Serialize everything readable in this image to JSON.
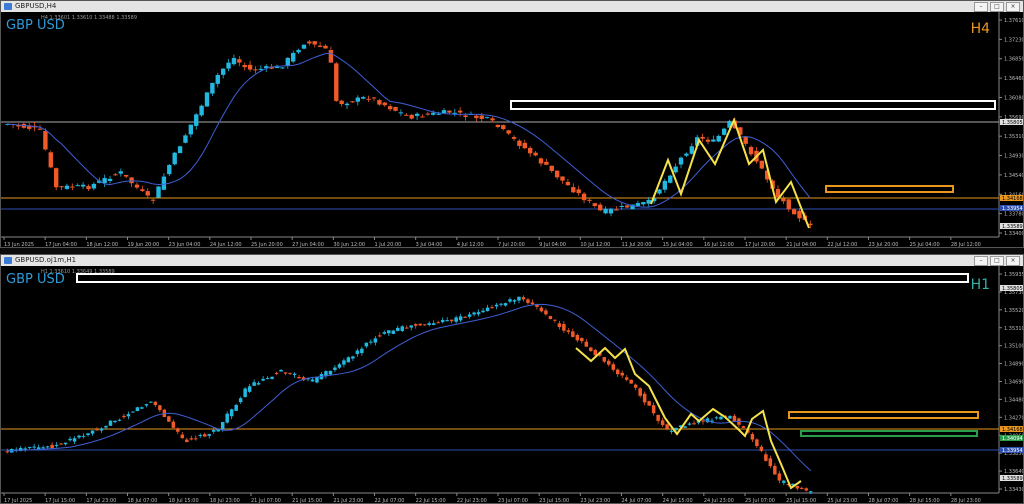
{
  "windows": [
    {
      "title": "GBPUSD,H4",
      "ohlc": "H4 1.33601 1.33610 1.33488 1.33589",
      "symbol": "GBP USD",
      "timeframe": "H4",
      "timeframe_color": "#e8961e",
      "price_labels": [
        "1.37610",
        "1.37230",
        "1.36850",
        "1.36460",
        "1.36080",
        "1.35690",
        "1.35310",
        "1.34930",
        "1.34540",
        "1.34160",
        "1.33780",
        "1.33400"
      ],
      "markers": [
        {
          "text": "1.35805",
          "price": 1.35805,
          "bg": "#e0e0e0",
          "fg": "#000000"
        },
        {
          "text": "1.34168",
          "price": 1.34168,
          "bg": "#e8961e",
          "fg": "#000000"
        },
        {
          "text": "1.33954",
          "price": 1.33954,
          "bg": "#2f4fb0",
          "fg": "#ffffff"
        },
        {
          "text": "1.33589",
          "price": 1.33589,
          "bg": "#e0e0e0",
          "fg": "#000000"
        }
      ],
      "time_labels": [
        "13 Jun 2025",
        "17 Jun 04:00",
        "18 Jun 12:00",
        "19 Jun 20:00",
        "23 Jun 04:00",
        "24 Jun 12:00",
        "25 Jun 20:00",
        "27 Jun 04:00",
        "30 Jun 12:00",
        "1 Jul 20:00",
        "3 Jul 04:00",
        "4 Jul 12:00",
        "7 Jul 20:00",
        "9 Jul 04:00",
        "10 Jul 12:00",
        "11 Jul 20:00",
        "15 Jul 04:00",
        "16 Jul 12:00",
        "17 Jul 20:00",
        "21 Jul 04:00",
        "22 Jul 12:00",
        "23 Jul 20:00",
        "25 Jul 04:00",
        "28 Jul 12:00"
      ],
      "colors": {
        "bull": "#22b8e0",
        "bear": "#f05a28",
        "ma": "#3e5fd6",
        "zigzag": "#f5e24a"
      }
    },
    {
      "title": "GBPUSD.oj1m,H1",
      "ohlc": "H1 1.33610 1.33649 1.33589",
      "symbol": "GBP USD",
      "timeframe": "H1",
      "timeframe_color": "#2fb0a8",
      "price_labels": [
        "1.35935",
        "1.35730",
        "1.35520",
        "1.35310",
        "1.35100",
        "1.34890",
        "1.34690",
        "1.34480",
        "1.34270",
        "1.34060",
        "1.33850",
        "1.33640",
        "1.33430"
      ],
      "markers": [
        {
          "text": "1.35805",
          "price": 1.35805,
          "bg": "#e0e0e0",
          "fg": "#000000"
        },
        {
          "text": "1.34168",
          "price": 1.34168,
          "bg": "#e8961e",
          "fg": "#000000"
        },
        {
          "text": "1.34094",
          "price": 1.34094,
          "bg": "#2a9d4a",
          "fg": "#ffffff"
        },
        {
          "text": "1.33954",
          "price": 1.33954,
          "bg": "#2f4fb0",
          "fg": "#ffffff"
        },
        {
          "text": "1.33589",
          "price": 1.33589,
          "bg": "#e0e0e0",
          "fg": "#000000"
        }
      ],
      "time_labels": [
        "17 Jul 2025",
        "17 Jul 15:00",
        "17 Jul 23:00",
        "18 Jul 07:00",
        "18 Jul 15:00",
        "18 Jul 23:00",
        "21 Jul 07:00",
        "21 Jul 15:00",
        "21 Jul 23:00",
        "22 Jul 07:00",
        "22 Jul 15:00",
        "22 Jul 23:00",
        "23 Jul 07:00",
        "23 Jul 15:00",
        "23 Jul 23:00",
        "24 Jul 07:00",
        "24 Jul 15:00",
        "24 Jul 23:00",
        "25 Jul 07:00",
        "25 Jul 15:00",
        "25 Jul 23:00",
        "28 Jul 07:00",
        "28 Jul 15:00",
        "28 Jul 23:00"
      ],
      "colors": {
        "bull": "#22b8e0",
        "bear": "#f05a28",
        "ma": "#3e5fd6",
        "zigzag": "#f5e24a"
      }
    }
  ],
  "window_buttons": [
    "–",
    "□",
    "×"
  ]
}
